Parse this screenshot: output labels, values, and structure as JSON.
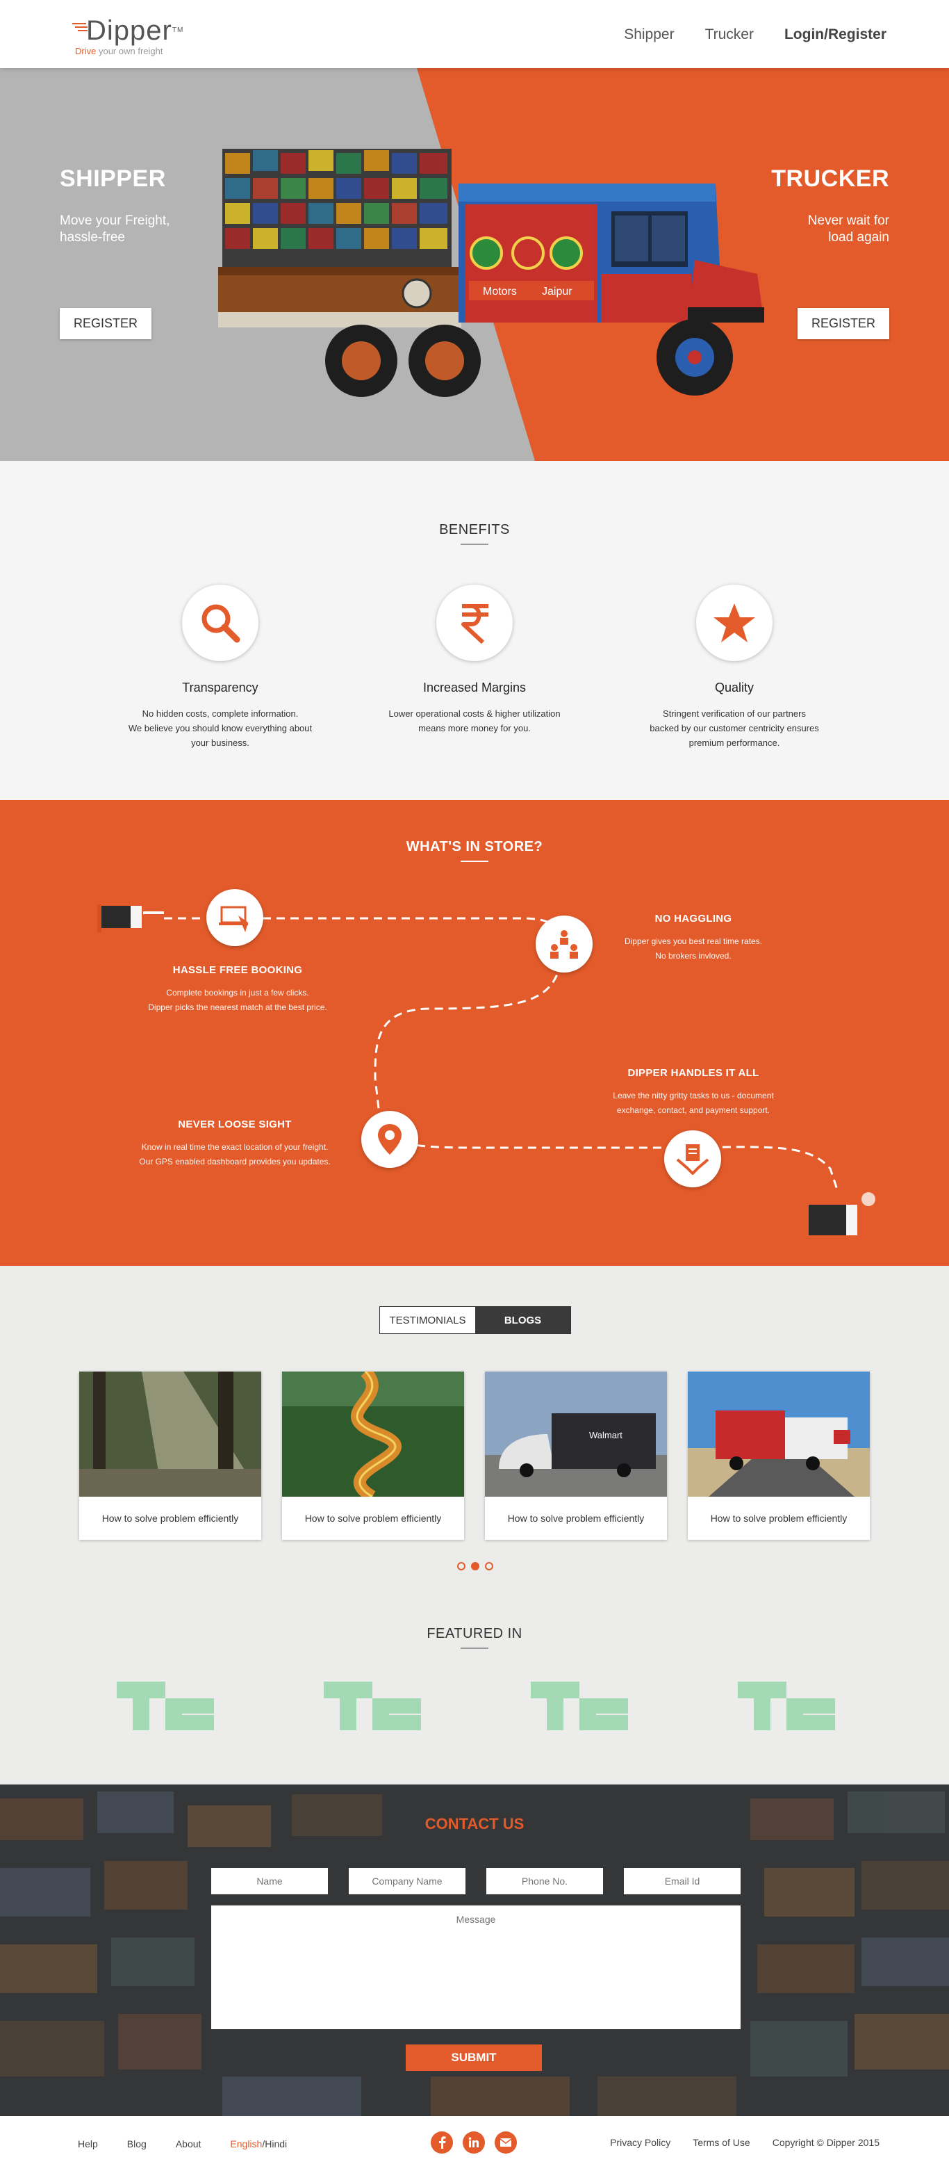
{
  "header": {
    "logo_text": "Dipper",
    "logo_tm": "TM",
    "tagline_highlight": "Drive",
    "tagline_rest": "your own freight",
    "nav": [
      "Shipper",
      "Trucker",
      "Login/Register"
    ]
  },
  "hero": {
    "shipper": {
      "title": "SHIPPER",
      "subtitle_line1": "Move your Freight,",
      "subtitle_line2": "hassle-free",
      "button": "REGISTER"
    },
    "trucker": {
      "title": "TRUCKER",
      "subtitle_line1": "Never wait for",
      "subtitle_line2": "load again",
      "button": "REGISTER"
    },
    "truck_text": {
      "motors": "Motors",
      "jaipur": "Jaipur"
    },
    "colors": {
      "orange": "#e35b2a",
      "grey": "#b4b4b4"
    }
  },
  "benefits": {
    "title": "BENEFITS",
    "items": [
      {
        "icon": "search-icon",
        "name": "Transparency",
        "desc_lines": [
          "No hidden costs, complete information.",
          "We believe you should know everything about",
          "your business."
        ]
      },
      {
        "icon": "rupee-icon",
        "name": "Increased Margins",
        "desc_lines": [
          "Lower operational costs & higher utilization",
          "means more money for you."
        ]
      },
      {
        "icon": "star-icon",
        "name": "Quality",
        "desc_lines": [
          "Stringent verification of our partners",
          "backed by our customer centricity ensures",
          "premium performance."
        ]
      }
    ]
  },
  "store": {
    "title": "WHAT'S IN STORE?",
    "features": [
      {
        "title": "HASSLE FREE BOOKING",
        "desc_lines": [
          "Complete bookings in just a few clicks.",
          "Dipper picks the nearest match at the best price."
        ]
      },
      {
        "title": "NO HAGGLING",
        "desc_lines": [
          "Dipper gives you best real time rates.",
          "No brokers invloved."
        ]
      },
      {
        "title": "DIPPER HANDLES IT ALL",
        "desc_lines": [
          "Leave the nitty gritty tasks to us - document",
          "exchange, contact, and payment support."
        ]
      },
      {
        "title": "NEVER LOOSE SIGHT",
        "desc_lines": [
          "Know in real time the exact location of your freight.",
          "Our GPS enabled dashboard provides you updates."
        ]
      }
    ]
  },
  "blogs": {
    "tabs": [
      "TESTIMONIALS",
      "BLOGS"
    ],
    "active_tab": "BLOGS",
    "cards": [
      {
        "caption": "How to solve problem efficiently",
        "image": "forest-sunbeams"
      },
      {
        "caption": "How to solve problem efficiently",
        "image": "winding-road"
      },
      {
        "caption": "How to solve problem efficiently",
        "image": "walmart-truck"
      },
      {
        "caption": "How to solve problem efficiently",
        "image": "red-truck-highway"
      }
    ],
    "carousel_active_index": 1,
    "truck_side_text": "Walmart"
  },
  "featured": {
    "title": "FEATURED IN",
    "logos": [
      "techcrunch-logo",
      "techcrunch-logo",
      "techcrunch-logo",
      "techcrunch-logo"
    ],
    "logo_color": "#a4d9b6"
  },
  "contact": {
    "title": "CONTACT US",
    "placeholders": {
      "name": "Name",
      "company": "Company Name",
      "phone": "Phone No.",
      "email": "Email Id",
      "message": "Message"
    },
    "submit": "SUBMIT"
  },
  "footer": {
    "links_left": [
      "Help",
      "Blog",
      "About"
    ],
    "lang_en": "English",
    "lang_sep": "/",
    "lang_hi": "Hindi",
    "social": [
      "facebook-icon",
      "linkedin-icon",
      "mail-icon"
    ],
    "links_right": [
      "Privacy Policy",
      "Terms of Use"
    ],
    "copyright": "Copyright © Dipper 2015"
  }
}
